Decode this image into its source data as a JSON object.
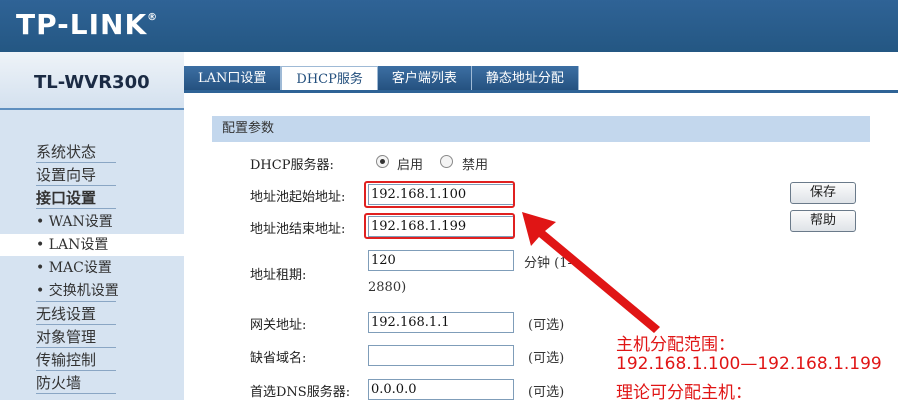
{
  "header": {
    "brand": "TP-LINK",
    "brand_mark": "®",
    "model": "TL-WVR300"
  },
  "tabs": [
    {
      "label": "LAN口设置",
      "active": false
    },
    {
      "label": "DHCP服务",
      "active": true
    },
    {
      "label": "客户端列表",
      "active": false
    },
    {
      "label": "静态地址分配",
      "active": false
    }
  ],
  "sidebar": {
    "items": [
      {
        "label": "系统状态"
      },
      {
        "label": "设置向导"
      },
      {
        "label": "接口设置"
      },
      {
        "label": "• WAN设置"
      },
      {
        "label": "• LAN设置"
      },
      {
        "label": "• MAC设置"
      },
      {
        "label": "• 交换机设置"
      },
      {
        "label": "无线设置"
      },
      {
        "label": "对象管理"
      },
      {
        "label": "传输控制"
      },
      {
        "label": "防火墙"
      }
    ]
  },
  "section": {
    "title": "配置参数"
  },
  "form": {
    "dhcp_server": {
      "label": "DHCP服务器:",
      "option_on": "启用",
      "option_off": "禁用",
      "selected": "启用"
    },
    "pool_start": {
      "label": "地址池起始地址:",
      "value": "192.168.1.100"
    },
    "pool_end": {
      "label": "地址池结束地址:",
      "value": "192.168.1.199"
    },
    "lease": {
      "label": "地址租期:",
      "value": "120",
      "unit": "分钟 (1-",
      "range_end": "2880)"
    },
    "gateway": {
      "label": "网关地址:",
      "value": "192.168.1.1",
      "hint": "(可选)"
    },
    "domain": {
      "label": "缺省域名:",
      "value": "",
      "hint": "(可选)"
    },
    "dns_primary": {
      "label": "首选DNS服务器:",
      "value": "0.0.0.0",
      "hint": "(可选)"
    }
  },
  "buttons": {
    "save": "保存",
    "help": "帮助"
  },
  "annotation": {
    "line1": "主机分配范围：",
    "line2": "192.168.1.100—192.168.1.199",
    "line3": "理论可分配主机："
  },
  "colors": {
    "header_blue": "#2f6396",
    "sidebar_bg": "#d6e3f1",
    "section_bg": "#c3d7ed",
    "annotation_red": "#e01515"
  }
}
